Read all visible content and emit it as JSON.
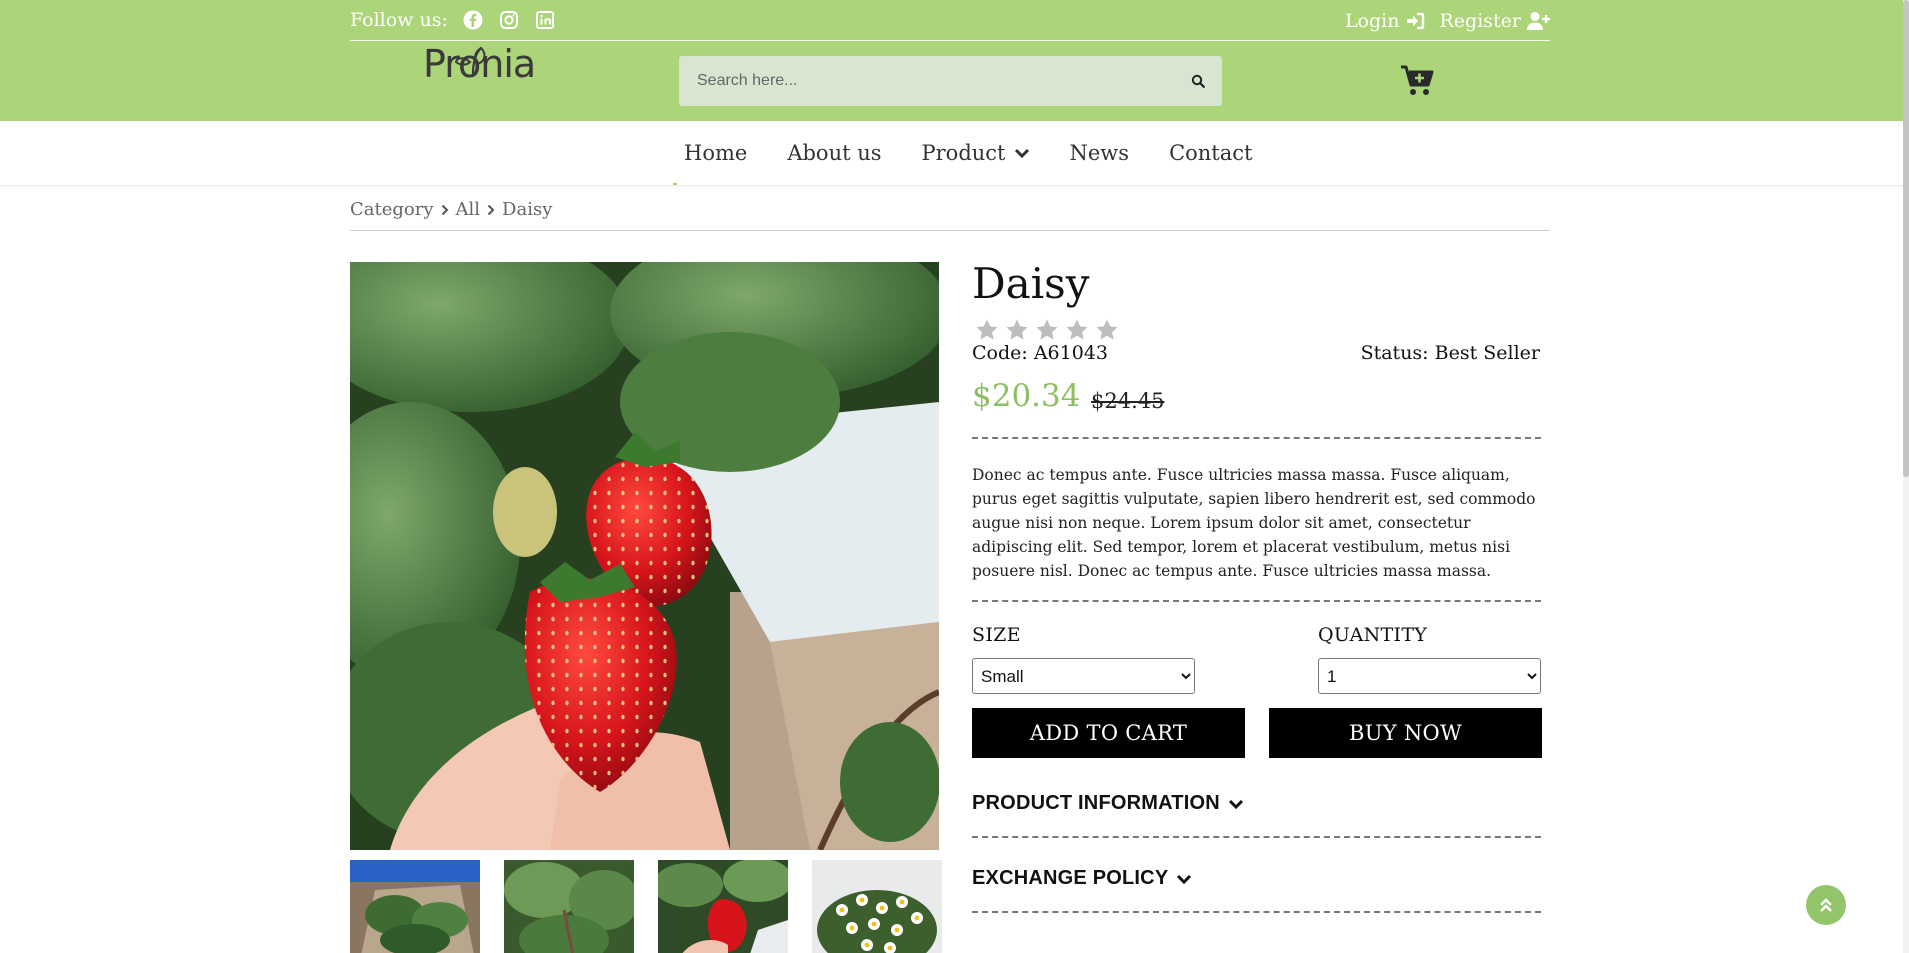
{
  "header": {
    "follow_label": "Follow us:",
    "social_icons": [
      "facebook-icon",
      "instagram-icon",
      "linkedin-icon"
    ],
    "login_label": "Login",
    "register_label": "Register",
    "logo_text": "Pronia",
    "search_placeholder": "Search here...",
    "brand_color": "#acd479"
  },
  "nav": {
    "items": [
      {
        "label": "Home"
      },
      {
        "label": "About us"
      },
      {
        "label": "Product"
      },
      {
        "label": "News"
      },
      {
        "label": "Contact"
      }
    ]
  },
  "breadcrumb": [
    "Category",
    "All",
    "Daisy"
  ],
  "product": {
    "title": "Daisy",
    "rating": 0,
    "rating_max": 5,
    "code": "Code: A61043",
    "status": "Status: Best Seller",
    "price": "$20.34",
    "old_price": "$24.45",
    "price_color": "#8cc063",
    "description": "Donec ac tempus ante. Fusce ultricies massa massa. Fusce aliquam, purus eget sagittis vulputate, sapien libero hendrerit est, sed commodo augue nisi non neque. Lorem ipsum dolor sit amet, consectetur adipiscing elit. Sed tempor, lorem et placerat vestibulum, metus nisi posuere nisl. Donec ac tempus ante. Fusce ultricies massa massa.",
    "size_label": "SIZE",
    "size_value": "Small",
    "quantity_label": "QUANTITY",
    "quantity_value": "1",
    "add_to_cart": "ADD TO CART",
    "buy_now": "BUY NOW",
    "accordion": [
      "PRODUCT INFORMATION",
      "EXCHANGE POLICY"
    ]
  }
}
